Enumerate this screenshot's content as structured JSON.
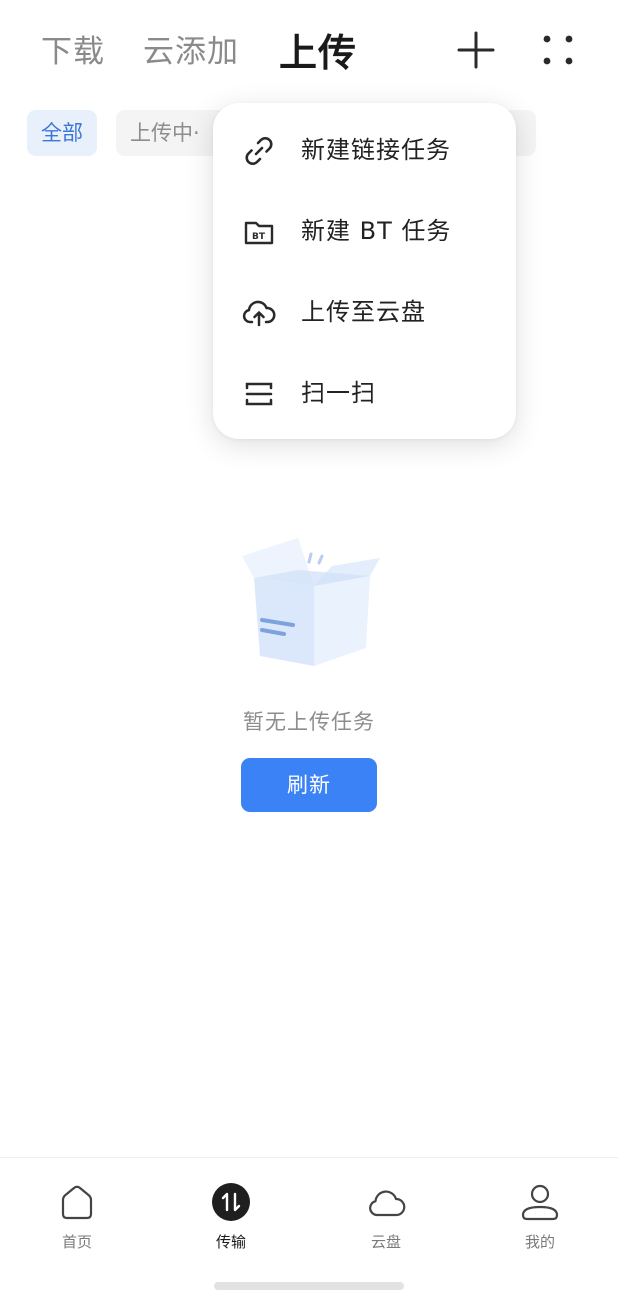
{
  "header": {
    "tabs": [
      {
        "label": "下载",
        "active": false
      },
      {
        "label": "云添加",
        "active": false
      },
      {
        "label": "上传",
        "active": true
      }
    ],
    "add_icon": "plus-icon",
    "more_icon": "four-dots-icon"
  },
  "filters": {
    "chips": [
      {
        "label": "全部",
        "active": true
      },
      {
        "label": "上传中·",
        "active": false
      }
    ],
    "hidden_tail": "0"
  },
  "menu": {
    "items": [
      {
        "label": "新建链接任务",
        "icon": "link-icon"
      },
      {
        "label": "新建 BT 任务",
        "icon": "bt-folder-icon"
      },
      {
        "label": "上传至云盘",
        "icon": "cloud-upload-icon"
      },
      {
        "label": "扫一扫",
        "icon": "scan-icon"
      }
    ]
  },
  "empty_state": {
    "illustration": "empty-box-illustration",
    "message": "暂无上传任务",
    "button_label": "刷新"
  },
  "bottom_nav": {
    "items": [
      {
        "label": "首页",
        "icon": "home-icon",
        "active": false
      },
      {
        "label": "传输",
        "icon": "transfer-icon",
        "active": true
      },
      {
        "label": "云盘",
        "icon": "cloud-icon",
        "active": false
      },
      {
        "label": "我的",
        "icon": "profile-icon",
        "active": false
      }
    ]
  },
  "colors": {
    "accent": "#3b82f6",
    "chip_active_bg": "#e8f0fc",
    "chip_active_text": "#3d77d6",
    "text_secondary": "#8a8a8a"
  }
}
